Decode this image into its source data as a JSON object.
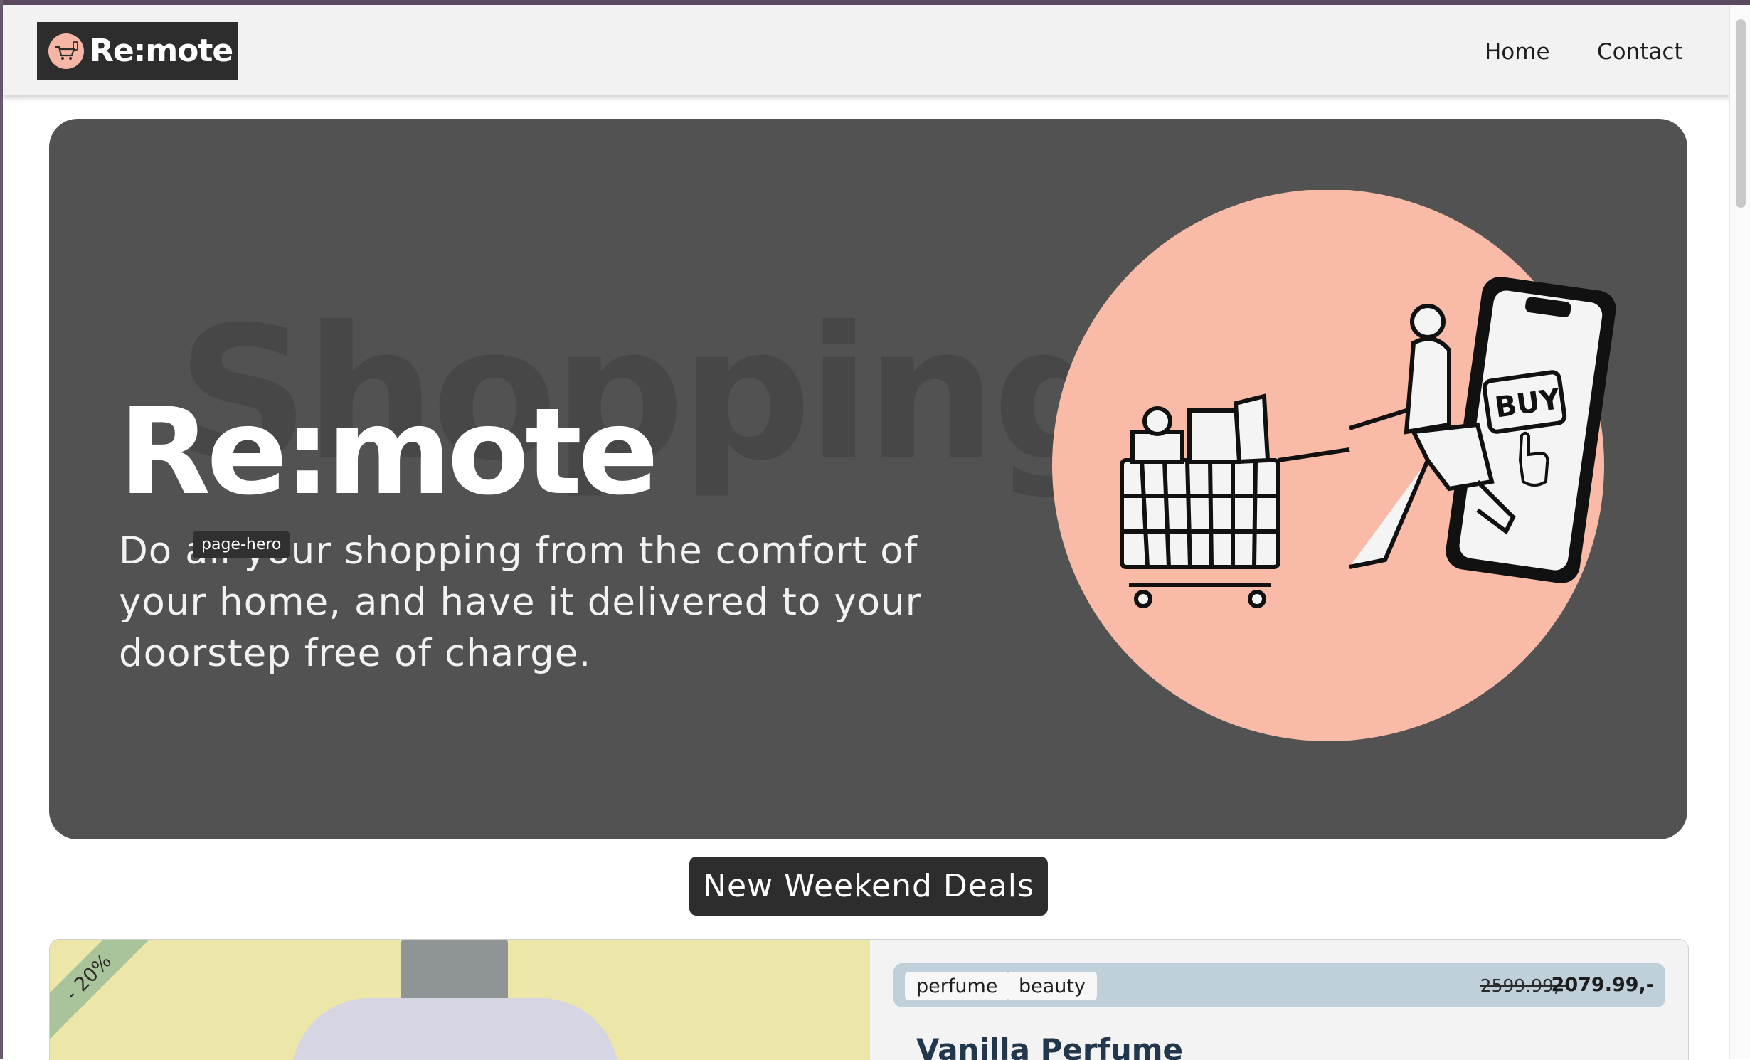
{
  "nav": {
    "brand": "Re:mote",
    "links": [
      "Home",
      "Contact"
    ]
  },
  "hero": {
    "bg_word": "Shopping",
    "title": "Re:mote",
    "subtitle": "Do all your shopping from the comfort of your home, and have it delivered to your doorstep free of charge.",
    "debug_tag": "page-hero",
    "illustration_button": "BUY"
  },
  "deals": {
    "title": "New Weekend Deals"
  },
  "product": {
    "discount": "- 20%",
    "tags": [
      "perfume",
      "beauty"
    ],
    "old_price": "2599.99,-",
    "new_price": "2079.99,-",
    "name": "Vanilla Perfume"
  },
  "colors": {
    "hero_bg": "#525252",
    "accent_circle": "#f9bba7",
    "dark": "#2d2d2d",
    "info_bar": "#bfd0db",
    "product_bg": "#ede6a9",
    "ribbon": "#a9c49a"
  }
}
